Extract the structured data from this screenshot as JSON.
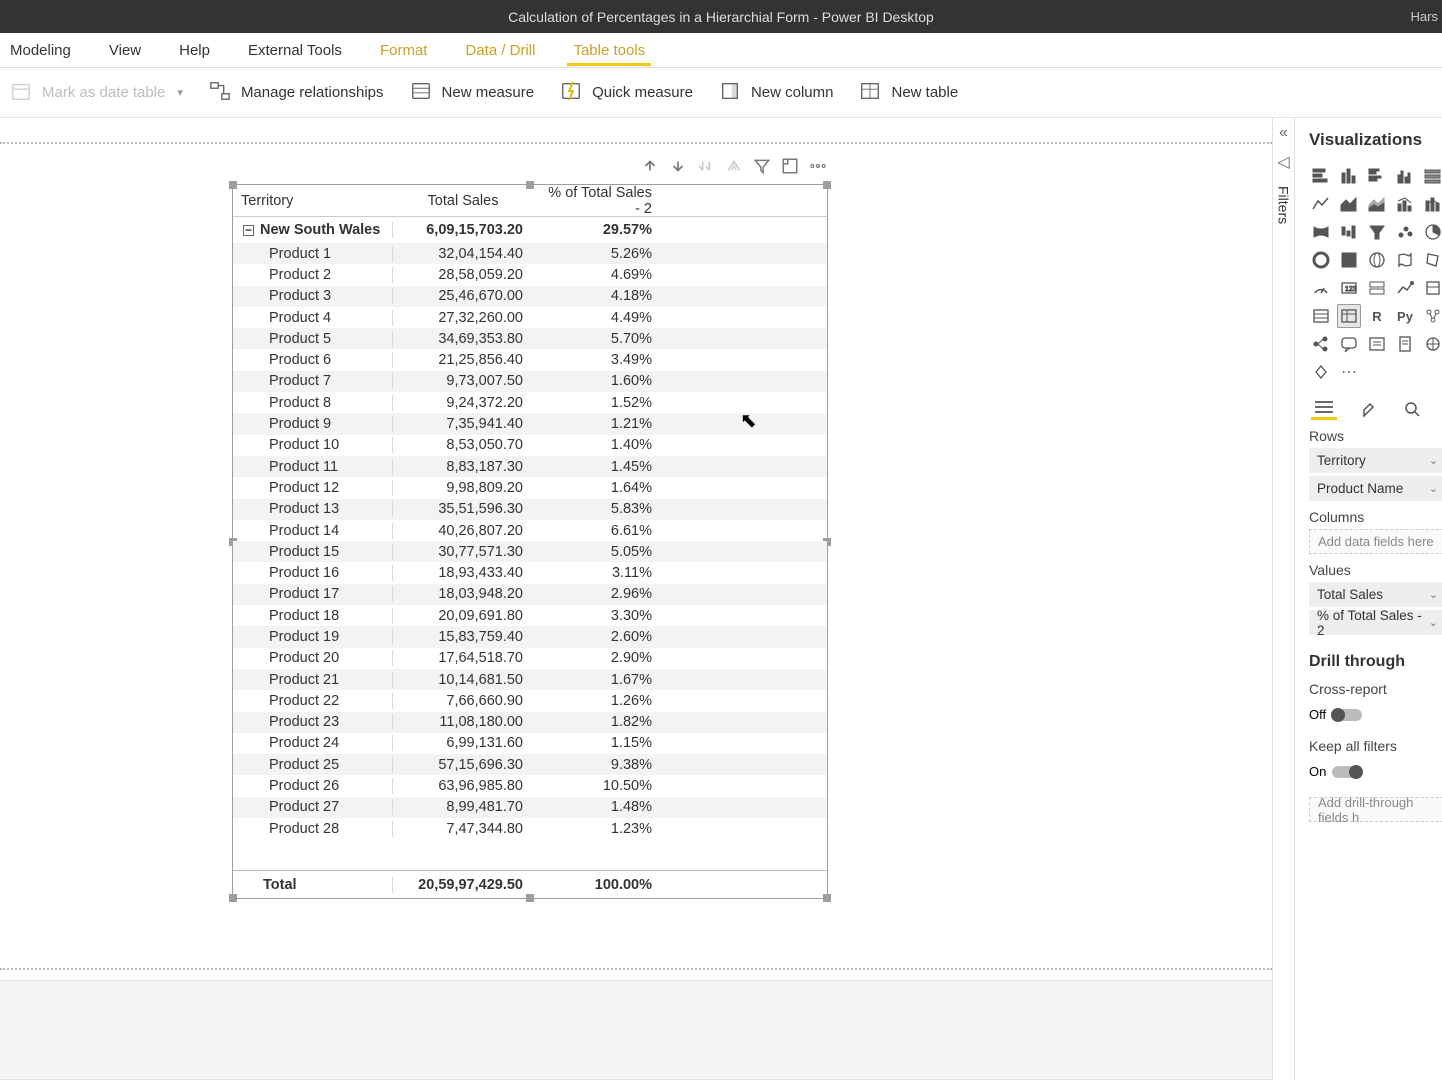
{
  "window": {
    "title": "Calculation of Percentages in a Hierarchial Form - Power BI Desktop",
    "right": "Hars"
  },
  "ribbon": {
    "tabs": {
      "modeling": "Modeling",
      "view": "View",
      "help": "Help",
      "external": "External Tools",
      "format": "Format",
      "datadrill": "Data / Drill",
      "tabletools": "Table tools"
    },
    "cmds": {
      "markAsDate": "Mark as date table",
      "manageRel": "Manage relationships",
      "newMeasure": "New measure",
      "quickMeasure": "Quick measure",
      "newColumn": "New column",
      "newTable": "New table"
    }
  },
  "filtersPane": {
    "label": "Filters"
  },
  "vizPane": {
    "title": "Visualizations",
    "rowsTitle": "Rows",
    "columnsTitle": "Columns",
    "valuesTitle": "Values",
    "rows": {
      "territory": "Territory",
      "productName": "Product Name"
    },
    "columnsPlaceholder": "Add data fields here",
    "values": {
      "totalSales": "Total Sales",
      "pctSales": "% of Total Sales - 2"
    },
    "drill": {
      "title": "Drill through",
      "crossReport": "Cross-report",
      "off": "Off",
      "keepAll": "Keep all filters",
      "on": "On",
      "placeholder": "Add drill-through fields h"
    }
  },
  "matrix": {
    "headers": {
      "territory": "Territory",
      "totalSales": "Total Sales",
      "pct": "% of Total Sales - 2"
    },
    "group": {
      "name": "New South Wales",
      "totalSales": "6,09,15,703.20",
      "pct": "29.57%"
    },
    "rows": [
      {
        "name": "Product 1",
        "ts": "32,04,154.40",
        "pc": "5.26%"
      },
      {
        "name": "Product 2",
        "ts": "28,58,059.20",
        "pc": "4.69%"
      },
      {
        "name": "Product 3",
        "ts": "25,46,670.00",
        "pc": "4.18%"
      },
      {
        "name": "Product 4",
        "ts": "27,32,260.00",
        "pc": "4.49%"
      },
      {
        "name": "Product 5",
        "ts": "34,69,353.80",
        "pc": "5.70%"
      },
      {
        "name": "Product 6",
        "ts": "21,25,856.40",
        "pc": "3.49%"
      },
      {
        "name": "Product 7",
        "ts": "9,73,007.50",
        "pc": "1.60%"
      },
      {
        "name": "Product 8",
        "ts": "9,24,372.20",
        "pc": "1.52%"
      },
      {
        "name": "Product 9",
        "ts": "7,35,941.40",
        "pc": "1.21%"
      },
      {
        "name": "Product 10",
        "ts": "8,53,050.70",
        "pc": "1.40%"
      },
      {
        "name": "Product 11",
        "ts": "8,83,187.30",
        "pc": "1.45%"
      },
      {
        "name": "Product 12",
        "ts": "9,98,809.20",
        "pc": "1.64%"
      },
      {
        "name": "Product 13",
        "ts": "35,51,596.30",
        "pc": "5.83%"
      },
      {
        "name": "Product 14",
        "ts": "40,26,807.20",
        "pc": "6.61%"
      },
      {
        "name": "Product 15",
        "ts": "30,77,571.30",
        "pc": "5.05%"
      },
      {
        "name": "Product 16",
        "ts": "18,93,433.40",
        "pc": "3.11%"
      },
      {
        "name": "Product 17",
        "ts": "18,03,948.20",
        "pc": "2.96%"
      },
      {
        "name": "Product 18",
        "ts": "20,09,691.80",
        "pc": "3.30%"
      },
      {
        "name": "Product 19",
        "ts": "15,83,759.40",
        "pc": "2.60%"
      },
      {
        "name": "Product 20",
        "ts": "17,64,518.70",
        "pc": "2.90%"
      },
      {
        "name": "Product 21",
        "ts": "10,14,681.50",
        "pc": "1.67%"
      },
      {
        "name": "Product 22",
        "ts": "7,66,660.90",
        "pc": "1.26%"
      },
      {
        "name": "Product 23",
        "ts": "11,08,180.00",
        "pc": "1.82%"
      },
      {
        "name": "Product 24",
        "ts": "6,99,131.60",
        "pc": "1.15%"
      },
      {
        "name": "Product 25",
        "ts": "57,15,696.30",
        "pc": "9.38%"
      },
      {
        "name": "Product 26",
        "ts": "63,96,985.80",
        "pc": "10.50%"
      },
      {
        "name": "Product 27",
        "ts": "8,99,481.70",
        "pc": "1.48%"
      },
      {
        "name": "Product 28",
        "ts": "7,47,344.80",
        "pc": "1.23%"
      }
    ],
    "footer": {
      "label": "Total",
      "ts": "20,59,97,429.50",
      "pc": "100.00%"
    }
  }
}
